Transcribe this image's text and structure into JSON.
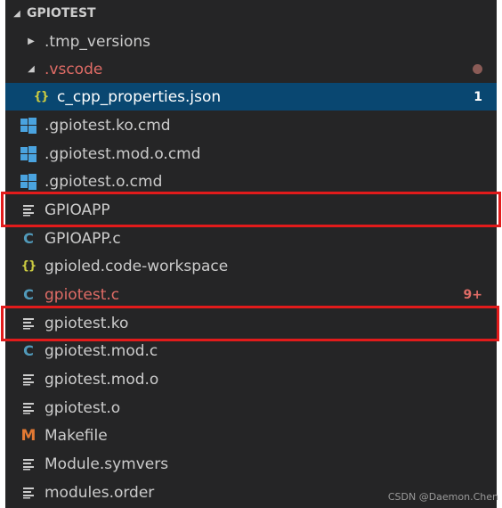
{
  "explorer": {
    "folder": "GPIOTEST",
    "items": [
      {
        "label": ".tmp_versions",
        "icon": "chevron-right-icon"
      },
      {
        "label": ".vscode",
        "icon": "chevron-down-icon"
      },
      {
        "label": "c_cpp_properties.json",
        "icon": "json-braces-icon",
        "badge": "1"
      },
      {
        "label": ".gpiotest.ko.cmd",
        "icon": "windows-cmd-icon"
      },
      {
        "label": ".gpiotest.mod.o.cmd",
        "icon": "windows-cmd-icon"
      },
      {
        "label": ".gpiotest.o.cmd",
        "icon": "windows-cmd-icon"
      },
      {
        "label": "GPIOAPP",
        "icon": "text-file-icon"
      },
      {
        "label": "GPIOAPP.c",
        "icon": "c-file-icon"
      },
      {
        "label": "gpioled.code-workspace",
        "icon": "json-braces-icon"
      },
      {
        "label": "gpiotest.c",
        "icon": "c-file-icon",
        "badge": "9+"
      },
      {
        "label": "gpiotest.ko",
        "icon": "text-file-icon"
      },
      {
        "label": "gpiotest.mod.c",
        "icon": "c-file-icon"
      },
      {
        "label": "gpiotest.mod.o",
        "icon": "text-file-icon"
      },
      {
        "label": "gpiotest.o",
        "icon": "text-file-icon"
      },
      {
        "label": "Makefile",
        "icon": "makefile-icon"
      },
      {
        "label": "Module.symvers",
        "icon": "text-file-icon"
      },
      {
        "label": "modules.order",
        "icon": "text-file-icon"
      }
    ]
  },
  "icons": {
    "c_glyph": "C",
    "braces_glyph": "{}",
    "make_glyph": "M"
  },
  "colors": {
    "panel_bg": "#252526",
    "selection_bg": "#094771",
    "error_text": "#e06c66",
    "highlight_box": "#e21b1b"
  },
  "watermark": "CSDN @Daemon.Chen"
}
